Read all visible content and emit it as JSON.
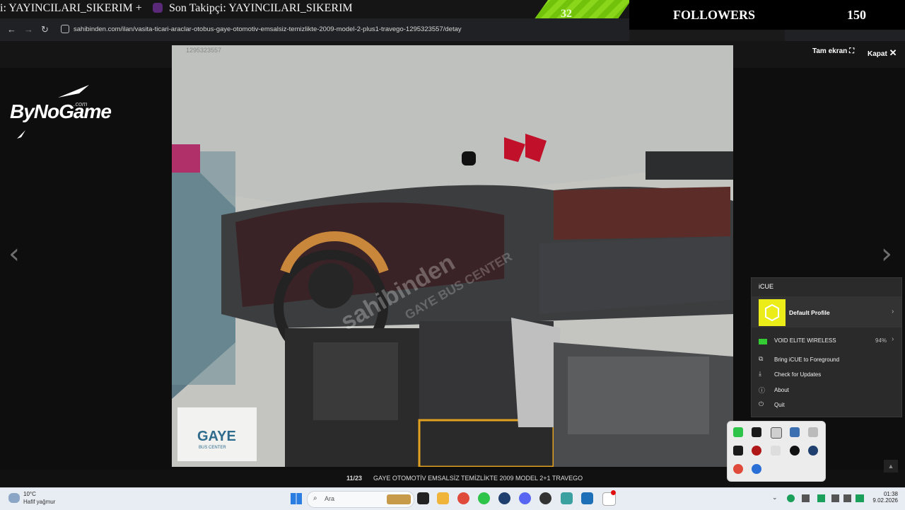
{
  "stream_overlay": {
    "ticker_text": "i: YAYINCILARI_SIKERIM +",
    "last_follower": "Son Takipçi: YAYINCILARI_SIKERIM",
    "stripe_count": "32",
    "followers_label": "FOLLOWERS",
    "followers_count": "150"
  },
  "browser": {
    "url": "sahibinden.com/ilan/vasita-ticari-araclar-otobus-gaye-otomotiv-emsalsiz-temizlikte-2009-model-2-plus1-travego-1295323557/detay"
  },
  "viewer": {
    "fullscreen_label": "Tam ekran",
    "close_label": "Kapat",
    "photo_watermark_id": "1295323557",
    "watermark": "sahibinden",
    "watermark_dealer": "GAYE BUS CENTER",
    "dealer_logo_name": "GAYE",
    "dealer_logo_sub": "BUS CENTER",
    "counter": "11/23",
    "caption": "GAYE OTOMOTİV EMSALSİZ TEMİZLİKTE 2009 MODEL 2+1 TRAVEGO"
  },
  "logo": {
    "text": "ByNoGame",
    "suffix": ".com"
  },
  "icue": {
    "title": "iCUE",
    "profile": "Default Profile",
    "device": "VOID ELITE WIRELESS",
    "battery": "94%",
    "items": [
      "Bring iCUE to Foreground",
      "Check for Updates",
      "About",
      "Quit"
    ],
    "accent": "#ecec18"
  },
  "taskbar": {
    "temp": "10°C",
    "weather": "Hafif yağmur",
    "search_placeholder": "Ara",
    "time": "01:38",
    "date": "9.02.2026"
  }
}
